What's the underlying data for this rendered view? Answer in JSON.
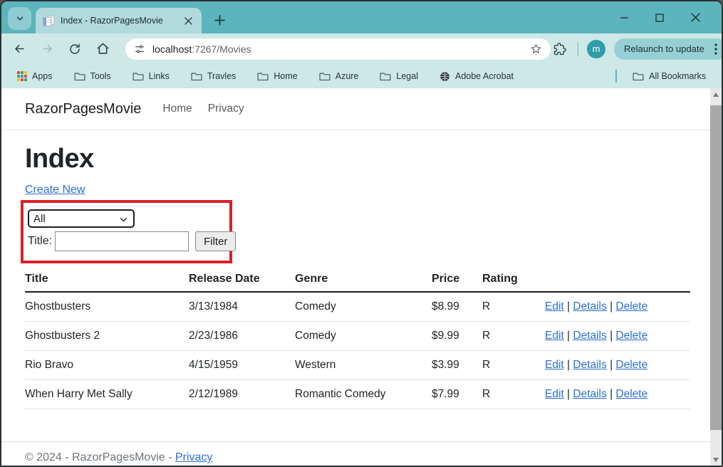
{
  "browser": {
    "tab_title": "Index - RazorPagesMovie",
    "url": {
      "host": "localhost",
      "path": ":7267/Movies"
    },
    "relaunch_label": "Relaunch to update",
    "avatar_letter": "m",
    "bookmarks": [
      {
        "label": "Apps",
        "icon": "apps-grid-icon"
      },
      {
        "label": "Tools",
        "icon": "folder-icon"
      },
      {
        "label": "Links",
        "icon": "folder-icon"
      },
      {
        "label": "Travles",
        "icon": "folder-icon"
      },
      {
        "label": "Home",
        "icon": "folder-icon"
      },
      {
        "label": "Azure",
        "icon": "folder-icon"
      },
      {
        "label": "Legal",
        "icon": "folder-icon"
      },
      {
        "label": "Adobe Acrobat",
        "icon": "globe-icon"
      }
    ],
    "all_bookmarks_label": "All Bookmarks"
  },
  "page": {
    "brand": "RazorPagesMovie",
    "nav_home": "Home",
    "nav_privacy": "Privacy",
    "heading": "Index",
    "create_new": "Create New",
    "filter": {
      "genre_value": "All",
      "title_label": "Title:",
      "filter_button": "Filter"
    },
    "table": {
      "headers": {
        "title": "Title",
        "release_date": "Release Date",
        "genre": "Genre",
        "price": "Price",
        "rating": "Rating"
      },
      "rows": [
        {
          "title": "Ghostbusters",
          "release_date": "3/13/1984",
          "genre": "Comedy",
          "price": "$8.99",
          "rating": "R"
        },
        {
          "title": "Ghostbusters 2",
          "release_date": "2/23/1986",
          "genre": "Comedy",
          "price": "$9.99",
          "rating": "R"
        },
        {
          "title": "Rio Bravo",
          "release_date": "4/15/1959",
          "genre": "Western",
          "price": "$3.99",
          "rating": "R"
        },
        {
          "title": "When Harry Met Sally",
          "release_date": "2/12/1989",
          "genre": "Romantic Comedy",
          "price": "$7.99",
          "rating": "R"
        }
      ],
      "actions": {
        "edit": "Edit",
        "details": "Details",
        "delete": "Delete",
        "separator": "|"
      }
    },
    "footer": {
      "copyright": "© 2024 - RazorPagesMovie -",
      "privacy_link": "Privacy"
    }
  },
  "colors": {
    "tabstrip_teal": "#5cb4bd",
    "toolbar_mint": "#cde8e6",
    "active_tab": "#b2dadd",
    "link_blue": "#2a6fdb",
    "annotation_red": "#dc2027"
  }
}
